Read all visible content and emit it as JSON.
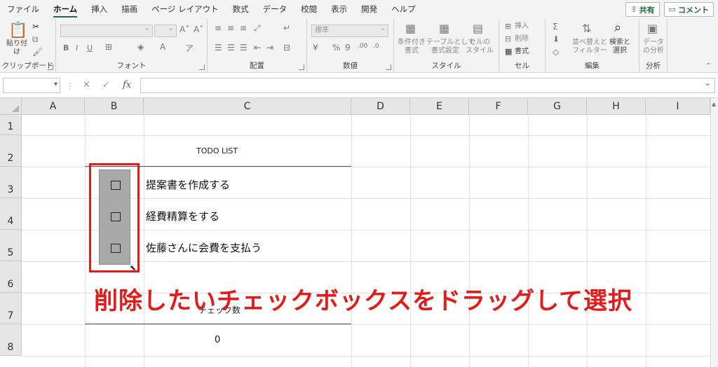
{
  "menu": {
    "tabs": [
      "ファイル",
      "ホーム",
      "挿入",
      "描画",
      "ページ レイアウト",
      "数式",
      "データ",
      "校閲",
      "表示",
      "開発",
      "ヘルプ"
    ],
    "active_tab": "ホーム",
    "share_label": "共有",
    "comment_label": "コメント"
  },
  "ribbon": {
    "clipboard": {
      "paste": "貼り付け",
      "label": "クリップボード"
    },
    "font": {
      "font_name": "",
      "font_size": "",
      "label": "フォント",
      "bold": "B",
      "italic": "I",
      "underline": "U"
    },
    "alignment": {
      "label": "配置"
    },
    "number": {
      "format": "標準",
      "label": "数値"
    },
    "styles": {
      "conditional": "条件付き\n書式",
      "table": "テーブルとして\n書式設定",
      "cell_styles": "セルの\nスタイル",
      "label": "スタイル"
    },
    "cells": {
      "insert": "挿入",
      "delete": "削除",
      "format": "書式",
      "label": "セル"
    },
    "editing": {
      "sort": "並べ替えと\nフィルター",
      "find": "検索と\n選択",
      "label": "編集"
    },
    "analysis": {
      "data": "データ\nの分析",
      "label": "分析"
    }
  },
  "formula_bar": {
    "name_box": "",
    "fx": "fx",
    "content": ""
  },
  "sheet": {
    "columns": [
      "A",
      "B",
      "C",
      "D",
      "E",
      "F",
      "G",
      "H",
      "I"
    ],
    "rows": [
      "1",
      "2",
      "3",
      "4",
      "5",
      "6",
      "7",
      "8"
    ],
    "todo_title": "TODO LIST",
    "tasks": [
      "提案書を作成する",
      "経費精算をする",
      "佐藤さんに会費を支払う"
    ],
    "checkbox_glyph": "☐",
    "count_label": "チェック数",
    "count_value": "0"
  },
  "annotation": "削除したいチェックボックスをドラッグして選択",
  "colors": {
    "accent": "#1e6c3c",
    "annotation": "#e31b1b",
    "checkbox_group_bg": "#a9a9a9"
  }
}
